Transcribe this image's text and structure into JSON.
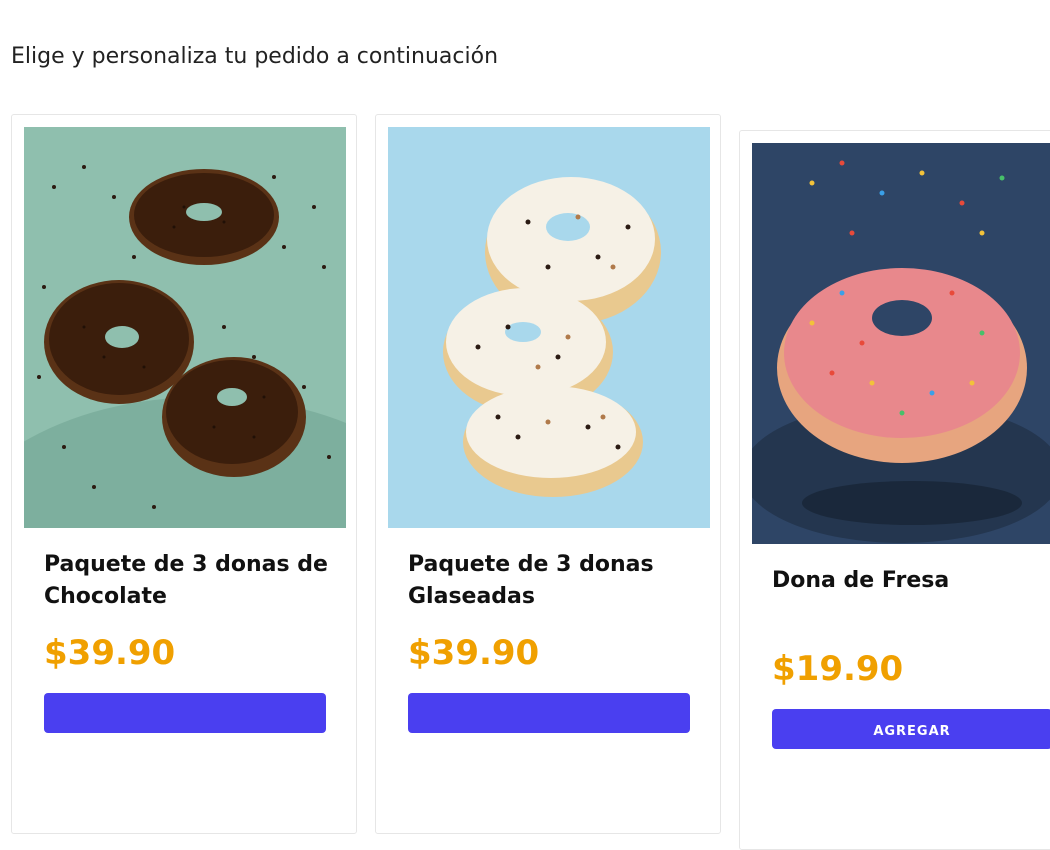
{
  "page": {
    "subtitle": "Elige y personaliza tu pedido a continuación"
  },
  "products": [
    {
      "name": "Paquete de 3 donas de Chocolate",
      "price": "$39.90",
      "button_label": "",
      "image_icon": "chocolate-donuts-image"
    },
    {
      "name": "Paquete de 3 donas Glaseadas",
      "price": "$39.90",
      "button_label": "",
      "image_icon": "glazed-donuts-image"
    },
    {
      "name": "Dona de Fresa",
      "price": "$19.90",
      "button_label": "AGREGAR",
      "image_icon": "strawberry-donut-image"
    }
  ],
  "colors": {
    "price": "#f0a000",
    "button": "#4a3ff0",
    "chocolate_bg": "#8fbfae",
    "glazed_bg": "#a9d8ec",
    "strawberry_bg": "#2e4566"
  }
}
